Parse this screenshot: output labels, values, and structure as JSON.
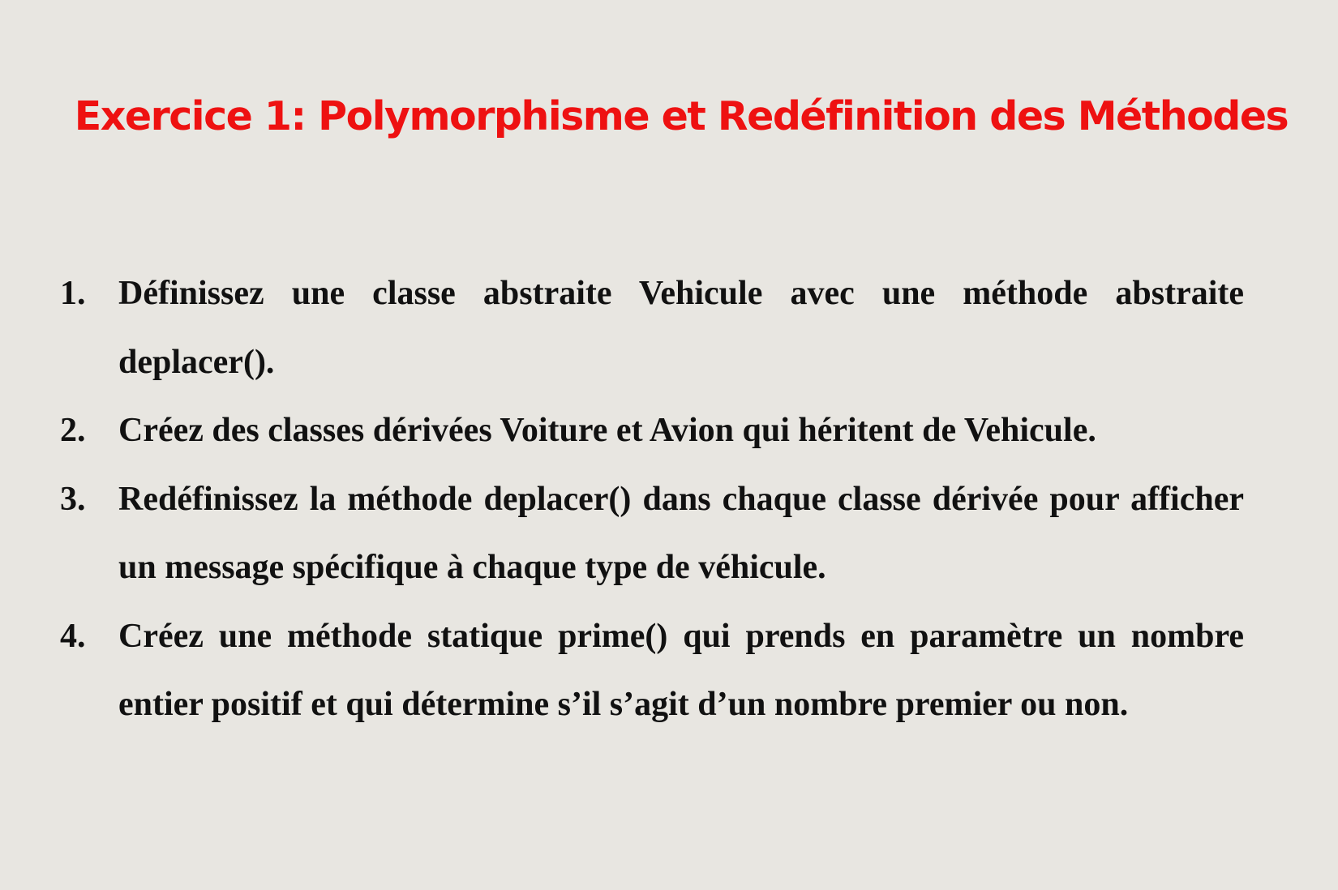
{
  "slide": {
    "title": "Exercice 1: Polymorphisme et Redéfinition des Méthodes",
    "title_color": "#ee1111",
    "background_color": "#e8e6e1",
    "items": [
      {
        "number": "1.",
        "text": "Définissez une classe abstraite Vehicule avec une méthode abstraite deplacer()."
      },
      {
        "number": "2.",
        "text": "Créez des classes dérivées Voiture et Avion qui héritent de Vehicule."
      },
      {
        "number": "3.",
        "text": "Redéfinissez la méthode deplacer() dans chaque classe dérivée pour afficher un message spécifique à chaque type de véhicule."
      },
      {
        "number": "4.",
        "text": "Créez une méthode statique prime() qui prends en paramètre un nombre entier positif et qui détermine s’il s’agit d’un nombre premier ou non."
      }
    ]
  }
}
